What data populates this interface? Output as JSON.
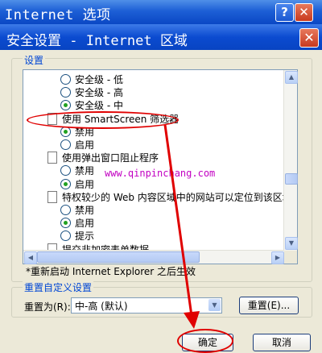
{
  "background_window": {
    "title": "Internet 选项",
    "help_glyph": "?",
    "close_glyph": "✕"
  },
  "dialog": {
    "title": "安全设置 - Internet 区域",
    "close_glyph": "✕",
    "settings_group_label": "设置",
    "settings_items": [
      {
        "type": "radio",
        "label": "安全级 - 低",
        "checked": false
      },
      {
        "type": "radio",
        "label": "安全级 - 高",
        "checked": false
      },
      {
        "type": "radio",
        "label": "安全级 - 中",
        "checked": true
      },
      {
        "type": "header",
        "label": "使用 SmartScreen 筛选器"
      },
      {
        "type": "radio",
        "label": "禁用",
        "checked": true
      },
      {
        "type": "radio",
        "label": "启用",
        "checked": false
      },
      {
        "type": "header",
        "label": "使用弹出窗口阻止程序"
      },
      {
        "type": "radio",
        "label": "禁用",
        "checked": false
      },
      {
        "type": "radio",
        "label": "启用",
        "checked": true
      },
      {
        "type": "header",
        "label": "特权较少的 Web 内容区域中的网站可以定位到该区域"
      },
      {
        "type": "radio",
        "label": "禁用",
        "checked": false
      },
      {
        "type": "radio",
        "label": "启用",
        "checked": true
      },
      {
        "type": "radio",
        "label": "提示",
        "checked": false
      },
      {
        "type": "header",
        "label": "提交非加密表单数据"
      }
    ],
    "restart_note": "*重新启动 Internet Explorer 之后生效",
    "reset_group_label": "重置自定义设置",
    "reset_to_label": "重置为(R):",
    "reset_dropdown_value": "中-高 (默认)",
    "reset_button_label": "重置(E)...",
    "ok_button_label": "确定",
    "cancel_button_label": "取消"
  },
  "watermark": "www.qinpinchang.com",
  "colors": {
    "titlebar": "#0a47c4",
    "group_label": "#0046d5",
    "annotation": "#e00000",
    "watermark": "#c200c2",
    "radio_dot": "#21a121"
  }
}
